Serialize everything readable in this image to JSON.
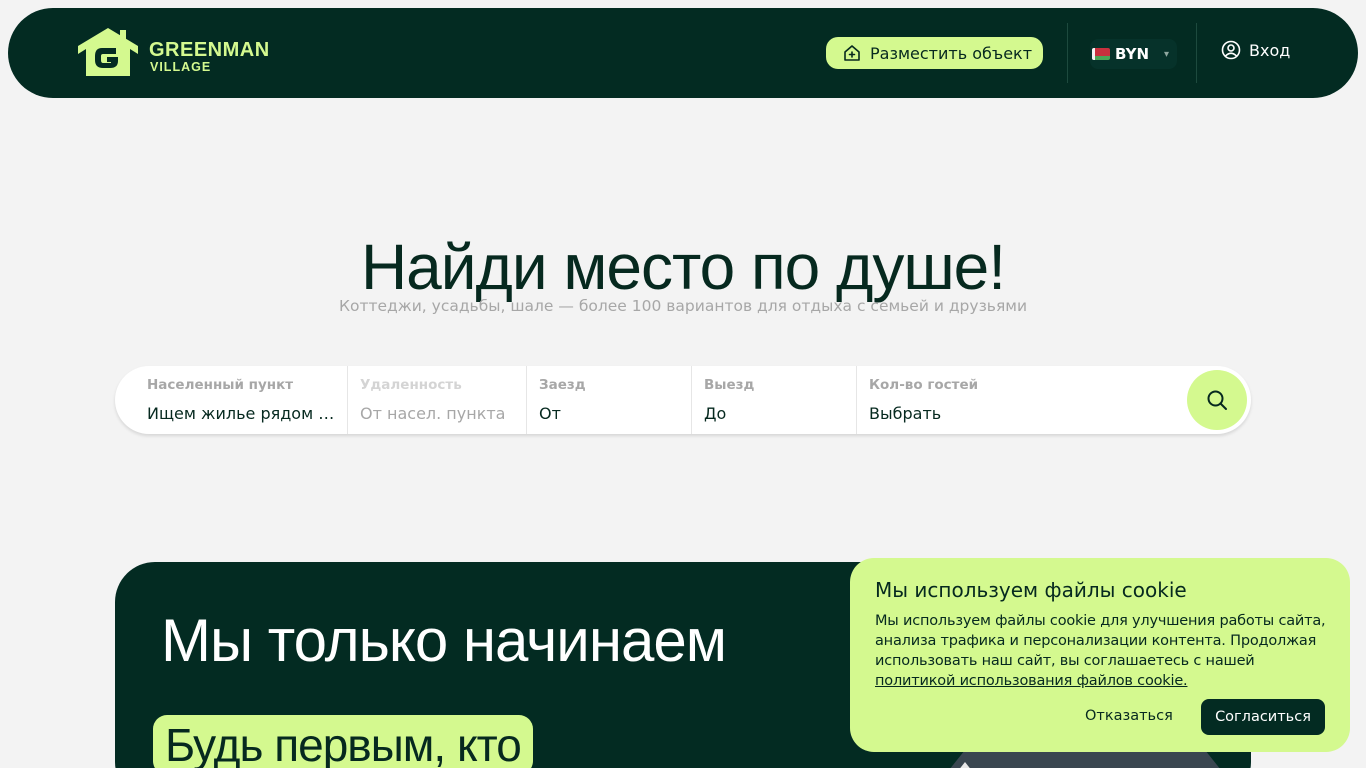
{
  "header": {
    "logo_word": "GREENMAN",
    "logo_sub": "VILLAGE",
    "place_button": "Разместить объект",
    "currency": "BYN",
    "login": "Вход"
  },
  "hero": {
    "title": "Найди место по душе!",
    "subtitle": "Коттеджи, усадьбы, шале — более 100 вариантов для отдыха с семьей и друзьями"
  },
  "search": {
    "fields": [
      {
        "label": "Населенный пункт",
        "value": "Ищем жилье рядом с..."
      },
      {
        "label": "Удаленность",
        "value": "От насел. пункта"
      },
      {
        "label": "Заезд",
        "value": "От"
      },
      {
        "label": "Выезд",
        "value": "До"
      },
      {
        "label": "Кол-во гостей",
        "value": "Выбрать"
      }
    ]
  },
  "banner": {
    "title": "Мы только начинаем",
    "chip": "Будь первым, кто"
  },
  "cookie": {
    "title": "Мы используем файлы cookie",
    "text": "Мы используем файлы cookie для улучшения работы сайта, анализа трафика и персонализации контента. Продолжая использовать наш сайт, вы соглашаетесь с нашей ",
    "link": "политикой использования файлов cookie.",
    "decline": "Отказаться",
    "accept": "Согласиться"
  },
  "colors": {
    "dark_green": "#032b22",
    "accent_lime": "#d4f98f",
    "background": "#f3f3f3"
  }
}
